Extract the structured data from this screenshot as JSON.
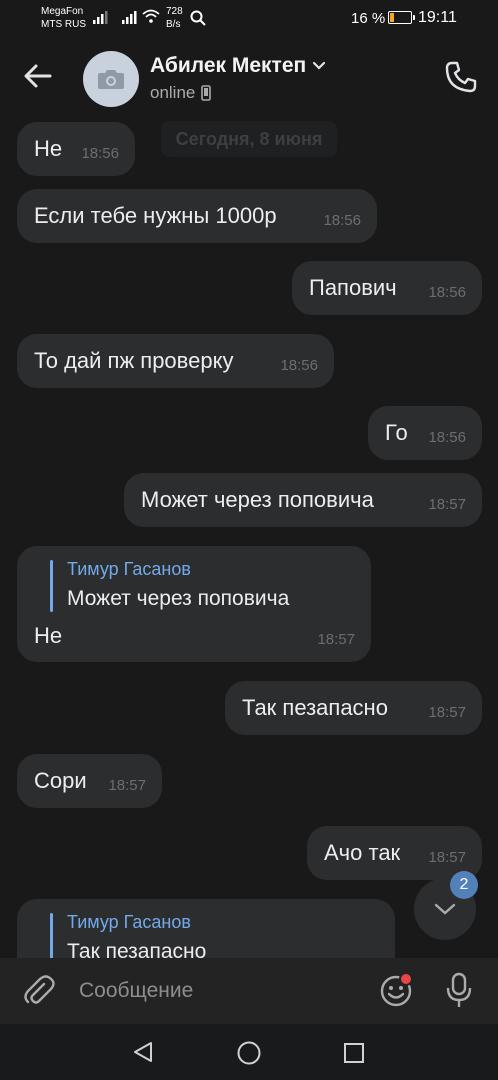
{
  "status_bar": {
    "carrier_1": "MegaFon",
    "carrier_2": "MTS RUS",
    "net_speed_value": "728",
    "net_speed_unit": "B/s",
    "battery_percent": "16 %",
    "time": "19:11"
  },
  "header": {
    "title": "Абилек Мектеп",
    "status": "online"
  },
  "date_separator": "Сегодня, 8 июня",
  "messages": [
    {
      "text": "Не",
      "time": "18:56",
      "direction": "in"
    },
    {
      "text": "Если тебе нужны 1000р",
      "time": "18:56",
      "direction": "in"
    },
    {
      "text": "Папович",
      "time": "18:56",
      "direction": "out"
    },
    {
      "text": "То дай пж проверку",
      "time": "18:56",
      "direction": "in"
    },
    {
      "text": "Го",
      "time": "18:56",
      "direction": "out"
    },
    {
      "text": "Может через поповича",
      "time": "18:57",
      "direction": "out"
    },
    {
      "reply_author": "Тимур Гасанов",
      "reply_text": "Может через поповича",
      "text": "Не",
      "time": "18:57",
      "direction": "in"
    },
    {
      "text": "Так пезапасно",
      "time": "18:57",
      "direction": "out"
    },
    {
      "text": "Сори",
      "time": "18:57",
      "direction": "in"
    },
    {
      "text": "Ачо так",
      "time": "18:57",
      "direction": "out"
    },
    {
      "reply_author": "Тимур Гасанов",
      "reply_text": "Так пезапасно",
      "direction": "in"
    }
  ],
  "scroll_down": {
    "unread_count": "2"
  },
  "composer": {
    "placeholder": "Сообщение"
  },
  "colors": {
    "background": "#19191a",
    "bubble": "#2c2d2e",
    "accent": "#71aaeb",
    "badge": "#5181b8",
    "notification_dot": "#e64646"
  }
}
